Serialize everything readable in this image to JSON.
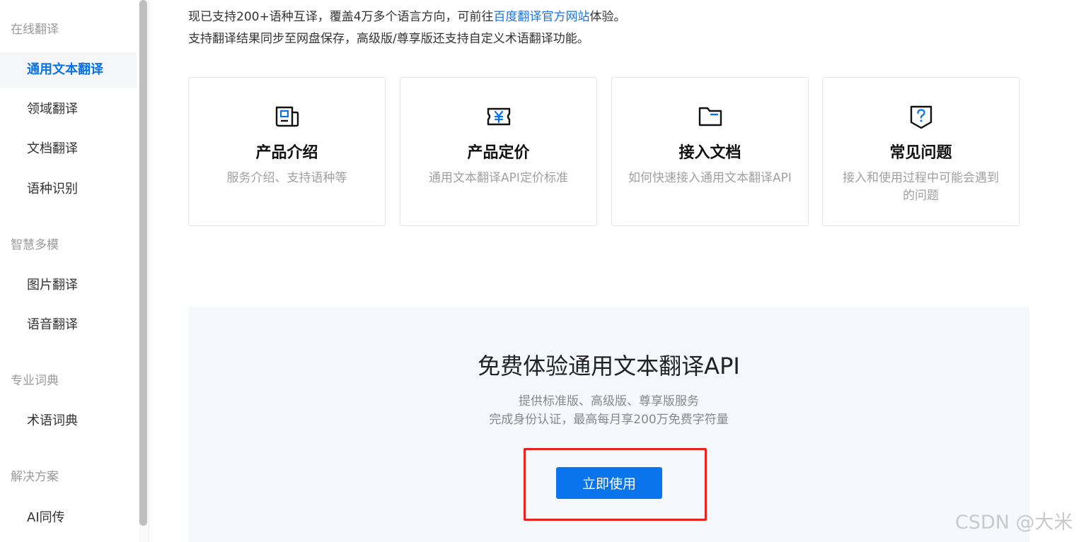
{
  "sidebar": {
    "groups": [
      {
        "label": "在线翻译"
      },
      {
        "label": "智慧多模"
      },
      {
        "label": "专业词典"
      },
      {
        "label": "解决方案"
      }
    ],
    "items": [
      {
        "label": "通用文本翻译",
        "active": true
      },
      {
        "label": "领域翻译"
      },
      {
        "label": "文档翻译"
      },
      {
        "label": "语种识别"
      },
      {
        "label": "图片翻译"
      },
      {
        "label": "语音翻译"
      },
      {
        "label": "术语词典"
      },
      {
        "label": "AI同传"
      }
    ]
  },
  "intro": {
    "line1_prefix": "现已支持200+语种互译，覆盖4万多个语言方向，可前往",
    "line1_link": "百度翻译官方网站",
    "line1_suffix": "体验。",
    "line2": "支持翻译结果同步至网盘保存，高级版/尊享版还支持自定义术语翻译功能。"
  },
  "cards": [
    {
      "title": "产品介绍",
      "desc": "服务介绍、支持语种等",
      "icon": "newspaper-icon"
    },
    {
      "title": "产品定价",
      "desc": "通用文本翻译API定价标准",
      "icon": "yen-ticket-icon"
    },
    {
      "title": "接入文档",
      "desc": "如何快速接入通用文本翻译API",
      "icon": "folder-icon"
    },
    {
      "title": "常见问题",
      "desc": "接入和使用过程中可能会遇到的问题",
      "icon": "question-shield-icon"
    }
  ],
  "trial": {
    "title": "免费体验通用文本翻译API",
    "sub1": "提供标准版、高级版、尊享版服务",
    "sub2": "完成身份认证，最高每月享200万免费字符量",
    "button": "立即使用"
  },
  "watermark": "CSDN @大米",
  "colors": {
    "accent": "#0a74ec",
    "link": "#1a73e8",
    "highlight": "#e8231f",
    "trial_bg": "#f5f9fd"
  }
}
